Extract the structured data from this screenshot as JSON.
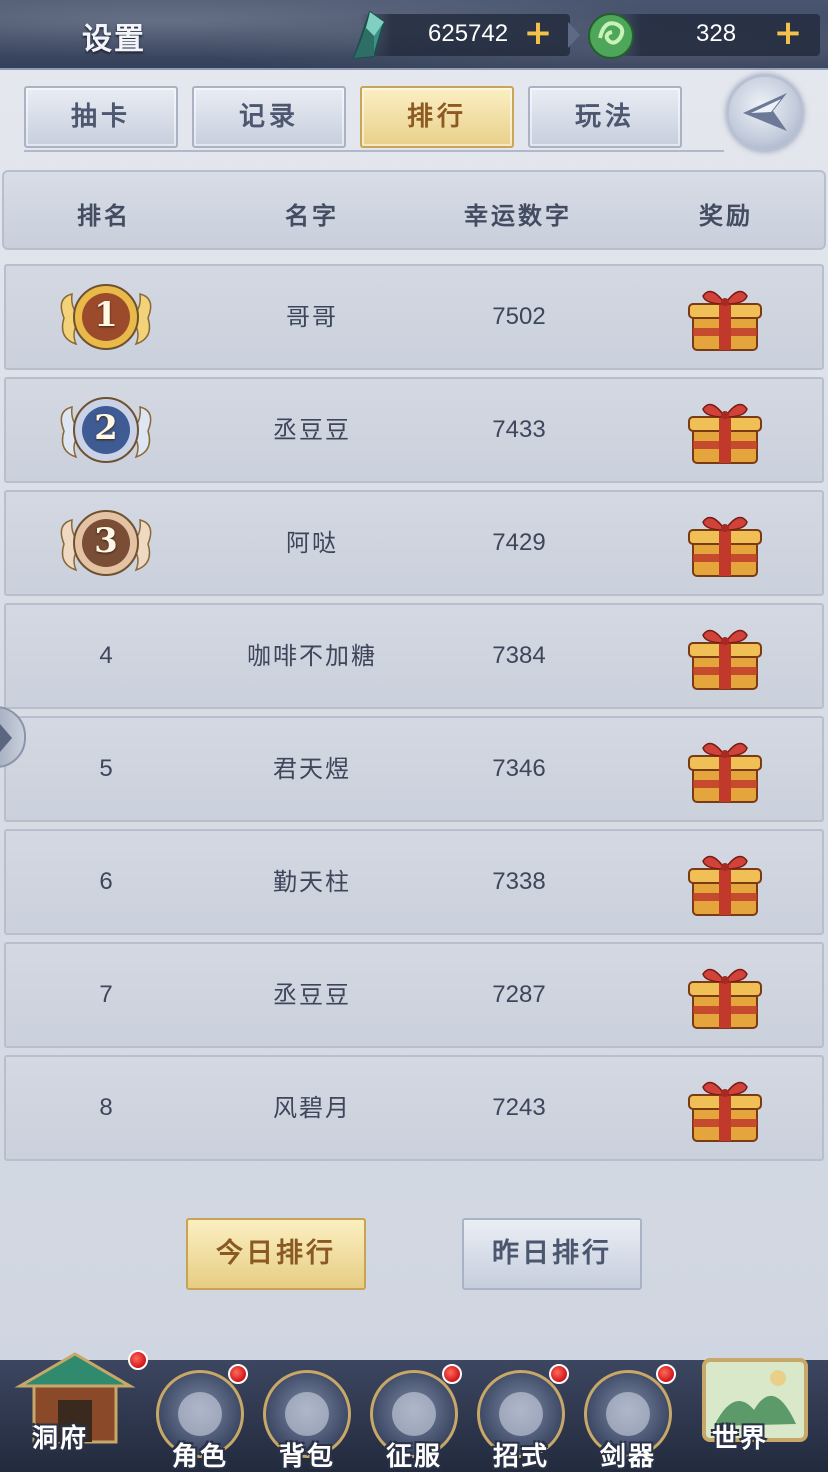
{
  "header": {
    "title": "设置",
    "jade": {
      "value": "625742",
      "icon": "jade-crystal-icon",
      "plus": "+"
    },
    "spirit": {
      "value": "328",
      "icon": "spirit-orb-icon",
      "plus": "+"
    }
  },
  "tabs": [
    {
      "label": "抽卡",
      "active": false
    },
    {
      "label": "记录",
      "active": false
    },
    {
      "label": "排行",
      "active": true
    },
    {
      "label": "玩法",
      "active": false
    }
  ],
  "table": {
    "headers": [
      "排名",
      "名字",
      "幸运数字",
      "奖励"
    ],
    "rows": [
      {
        "rank": "1",
        "name": "哥哥",
        "lucky": "7502",
        "medal": "gold"
      },
      {
        "rank": "2",
        "name": "丞豆豆",
        "lucky": "7433",
        "medal": "silver"
      },
      {
        "rank": "3",
        "name": "阿哒",
        "lucky": "7429",
        "medal": "bronze"
      },
      {
        "rank": "4",
        "name": "咖啡不加糖",
        "lucky": "7384"
      },
      {
        "rank": "5",
        "name": "君天煜",
        "lucky": "7346"
      },
      {
        "rank": "6",
        "name": "勤天柱",
        "lucky": "7338"
      },
      {
        "rank": "7",
        "name": "丞豆豆",
        "lucky": "7287"
      },
      {
        "rank": "8",
        "name": "风碧月",
        "lucky": "7243"
      }
    ]
  },
  "buttons": {
    "today": "今日排行",
    "yesterday": "昨日排行"
  },
  "nav": [
    {
      "label": "洞府",
      "badge": true
    },
    {
      "label": "角色",
      "badge": true
    },
    {
      "label": "背包",
      "badge": false
    },
    {
      "label": "征服",
      "badge": true
    },
    {
      "label": "招式",
      "badge": true
    },
    {
      "label": "剑器",
      "badge": true
    },
    {
      "label": "世界",
      "badge": false
    }
  ],
  "colors": {
    "accent_gold": "#e9d08a",
    "badge_red": "#d0141b",
    "panel": "#cfd5e0"
  }
}
